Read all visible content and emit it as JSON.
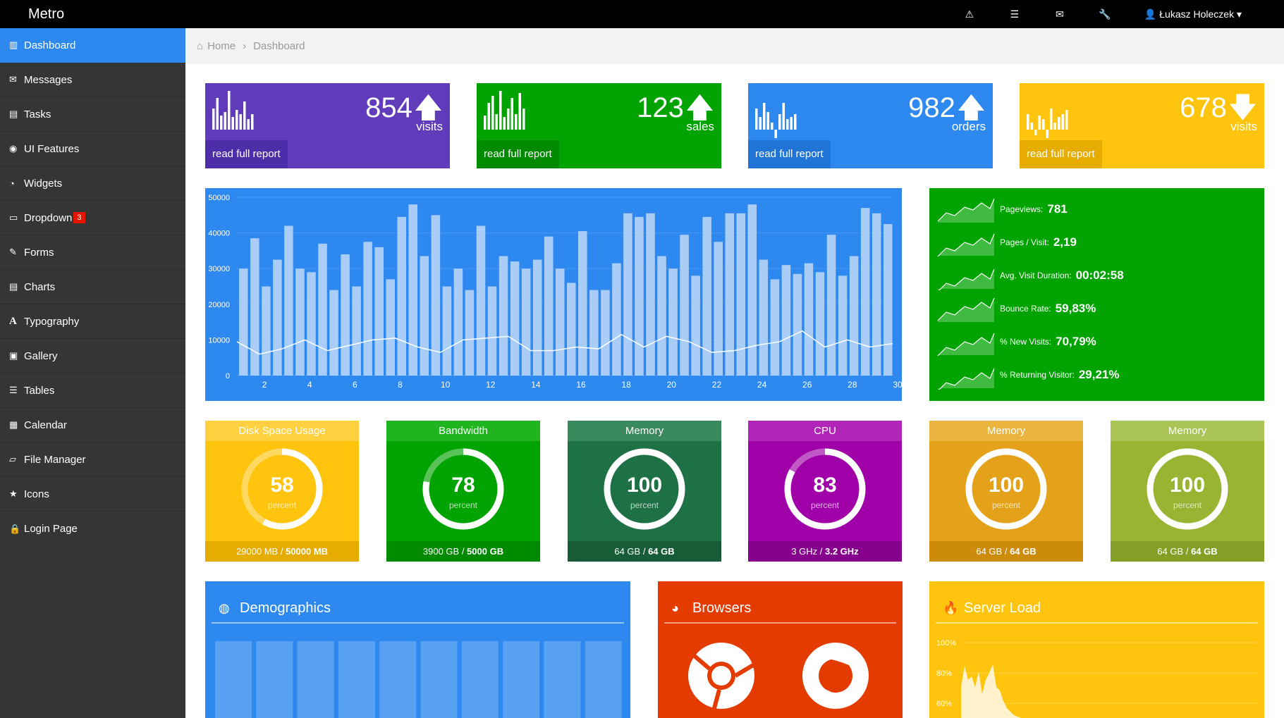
{
  "topbar": {
    "brand": "Metro",
    "icons": [
      "warning-icon",
      "list-icon",
      "envelope-icon",
      "wrench-icon"
    ],
    "user": "Łukasz Holeczek"
  },
  "sidebar": {
    "items": [
      {
        "label": "Dashboard",
        "icon": "bar-chart-icon"
      },
      {
        "label": "Messages",
        "icon": "envelope-icon"
      },
      {
        "label": "Tasks",
        "icon": "tasks-icon"
      },
      {
        "label": "UI Features",
        "icon": "eye-icon"
      },
      {
        "label": "Widgets",
        "icon": "dashboard-icon"
      },
      {
        "label": "Dropdown",
        "icon": "folder-icon",
        "badge": "3"
      },
      {
        "label": "Forms",
        "icon": "edit-icon"
      },
      {
        "label": "Charts",
        "icon": "list-alt-icon"
      },
      {
        "label": "Typography",
        "icon": "font-icon"
      },
      {
        "label": "Gallery",
        "icon": "picture-icon"
      },
      {
        "label": "Tables",
        "icon": "align-justify-icon"
      },
      {
        "label": "Calendar",
        "icon": "calendar-icon"
      },
      {
        "label": "File Manager",
        "icon": "folder-open-icon"
      },
      {
        "label": "Icons",
        "icon": "star-icon"
      },
      {
        "label": "Login Page",
        "icon": "lock-icon"
      }
    ]
  },
  "breadcrumb": {
    "home": "Home",
    "current": "Dashboard"
  },
  "tiles": [
    {
      "value": "854",
      "unit": "visits",
      "report": "read full report",
      "trend": "up",
      "color": "#603cba",
      "footcolor": "#4e2ea8"
    },
    {
      "value": "123",
      "unit": "sales",
      "report": "read full report",
      "trend": "up",
      "color": "#00a300",
      "footcolor": "#008a00"
    },
    {
      "value": "982",
      "unit": "orders",
      "report": "read full report",
      "trend": "up",
      "color": "#2d89ef",
      "footcolor": "#1f74d6"
    },
    {
      "value": "678",
      "unit": "visits",
      "report": "read full report",
      "trend": "down",
      "color": "#ffc40d",
      "footcolor": "#e6ad00"
    }
  ],
  "chart_data": {
    "type": "bar",
    "categories": [
      1,
      2,
      3,
      4,
      5,
      6,
      7,
      8,
      9,
      10,
      11,
      12,
      13,
      14,
      15,
      16,
      17,
      18,
      19,
      20,
      21,
      22,
      23,
      24,
      25,
      26,
      27,
      28,
      29,
      30
    ],
    "series": [
      {
        "values": [
          30000,
          38500,
          25000,
          32000,
          42000,
          30000,
          29000,
          37000,
          24000,
          34000,
          25000,
          37500,
          36000,
          27000,
          44500,
          48000,
          33500,
          45000,
          25000,
          30000,
          24000,
          42000,
          25000,
          33500,
          32000,
          30000,
          32500,
          39000,
          30000,
          26000
        ]
      },
      {
        "values": [
          9500,
          6000,
          7500,
          10000,
          7000,
          8500,
          10000,
          10500,
          8000,
          6500,
          10000,
          10500,
          11000,
          7000,
          7000,
          8000,
          7500,
          11500,
          8000,
          11000,
          9500,
          6500,
          7000,
          8500,
          9500,
          12500,
          8000,
          10000,
          8000,
          9000
        ]
      }
    ],
    "bars": [
      30000,
      38500,
      25000,
      32500,
      42000,
      30000,
      29000,
      37000,
      24000,
      34000,
      25000,
      37500,
      36000,
      27000,
      44500,
      48000,
      33500,
      45000,
      25000,
      30000,
      24000,
      42000,
      25000,
      33500,
      32000,
      30000,
      32500,
      39000,
      30000,
      26000,
      40500,
      24000,
      24000,
      31500,
      45500,
      44500,
      45500,
      33500,
      30000,
      39500,
      28000,
      44500,
      37500,
      45500,
      45500,
      48000,
      32500,
      27000,
      31000,
      28500,
      31500,
      29000,
      39500,
      28000,
      33500,
      47000,
      45500,
      42500
    ],
    "ylim": [
      0,
      50000
    ],
    "yticks": [
      0,
      10000,
      20000,
      30000,
      40000,
      50000
    ],
    "xticks": [
      2,
      4,
      6,
      8,
      10,
      12,
      14,
      16,
      18,
      20,
      22,
      24,
      26,
      28,
      30
    ]
  },
  "stats": [
    {
      "label": "Pageviews:",
      "value": "781"
    },
    {
      "label": "Pages / Visit:",
      "value": "2,19"
    },
    {
      "label": "Avg. Visit Duration:",
      "value": "00:02:58"
    },
    {
      "label": "Bounce Rate:",
      "value": "59,83%"
    },
    {
      "label": "% New Visits:",
      "value": "70,79%"
    },
    {
      "label": "% Returning Visitor:",
      "value": "29,21%"
    }
  ],
  "circles": [
    {
      "title": "Disk Space Usage",
      "percent": 58,
      "pct_label": "58",
      "unit": "percent",
      "used": "29000 MB",
      "total": "50000 MB",
      "color": "#ffc40d",
      "head": "#ffd040",
      "foot": "#e6ad00"
    },
    {
      "title": "Bandwidth",
      "percent": 78,
      "pct_label": "78",
      "unit": "percent",
      "used": "3900 GB",
      "total": "5000 GB",
      "color": "#00a300",
      "head": "#20b520",
      "foot": "#008a00"
    },
    {
      "title": "Memory",
      "percent": 100,
      "pct_label": "100",
      "unit": "percent",
      "used": "64 GB",
      "total": "64 GB",
      "color": "#1e7145",
      "head": "#3a8a5e",
      "foot": "#155c37"
    },
    {
      "title": "CPU",
      "percent": 83,
      "pct_label": "83",
      "unit": "percent",
      "used": "3 GHz",
      "total": "3.2 GHz",
      "color": "#9f00a7",
      "head": "#b225b9",
      "foot": "#86008d"
    },
    {
      "title": "Memory",
      "percent": 100,
      "pct_label": "100",
      "unit": "percent",
      "used": "64 GB",
      "total": "64 GB",
      "color": "#e3a21a",
      "head": "#e9b440",
      "foot": "#cc8c0a"
    },
    {
      "title": "Memory",
      "percent": 100,
      "pct_label": "100",
      "unit": "percent",
      "used": "64 GB",
      "total": "64 GB",
      "color": "#99b433",
      "head": "#aac455",
      "foot": "#849e26"
    }
  ],
  "boxes": [
    {
      "title": "Demographics",
      "icon": "globe-icon",
      "color": "#2d89ef"
    },
    {
      "title": "Browsers",
      "icon": "pie-icon",
      "color": "#e33b00"
    },
    {
      "title": "Server Load",
      "icon": "fire-icon",
      "color": "#ffc40d"
    }
  ],
  "serverload": {
    "yticks": [
      "100%",
      "80%",
      "60%"
    ]
  }
}
